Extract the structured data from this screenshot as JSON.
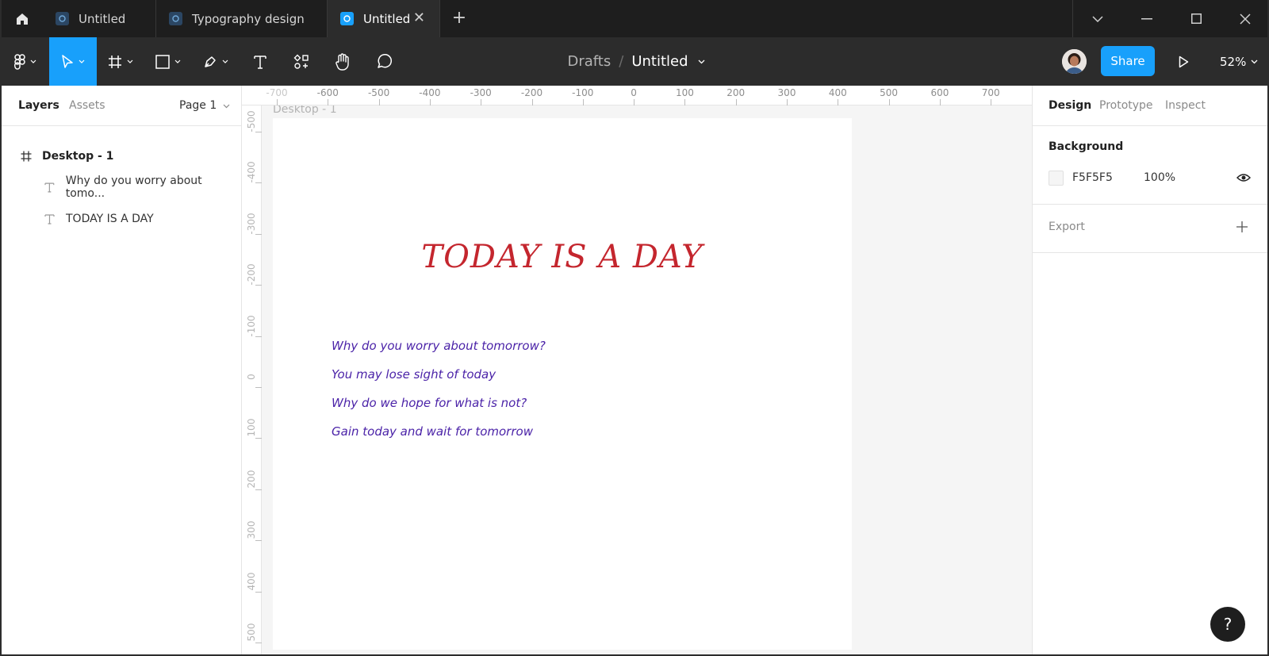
{
  "tabs": [
    {
      "label": "Untitled",
      "active": false
    },
    {
      "label": "Typography design",
      "active": false
    },
    {
      "label": "Untitled",
      "active": true
    }
  ],
  "toolbar": {
    "breadcrumb_root": "Drafts",
    "breadcrumb_sep": "/",
    "file_name": "Untitled",
    "share_label": "Share",
    "zoom": "52%"
  },
  "layers_panel": {
    "tab_layers": "Layers",
    "tab_assets": "Assets",
    "page": "Page 1",
    "items": [
      {
        "label": "Desktop - 1",
        "type": "frame"
      },
      {
        "label": "Why do you worry about tomo...",
        "type": "text"
      },
      {
        "label": "TODAY IS A DAY",
        "type": "text"
      }
    ]
  },
  "rulers": {
    "horizontal": [
      "-700",
      "-600",
      "-500",
      "-400",
      "-300",
      "-200",
      "-100",
      "0",
      "100",
      "200",
      "300",
      "400",
      "500",
      "600",
      "700"
    ],
    "vertical": [
      "-500",
      "-400",
      "-300",
      "-200",
      "-100",
      "0",
      "100",
      "200",
      "300",
      "400",
      "500"
    ]
  },
  "canvas": {
    "frame_label": "Desktop - 1",
    "heading": "TODAY IS A DAY",
    "heading_color": "#c4262e",
    "lines": [
      "Why do you worry about tomorrow?",
      "You may lose sight of today",
      "Why do we hope for what is not?",
      "Gain today and wait for tomorrow"
    ],
    "lines_color": "#4b23a8"
  },
  "design_panel": {
    "tab_design": "Design",
    "tab_prototype": "Prototype",
    "tab_inspect": "Inspect",
    "background_title": "Background",
    "background_hex": "F5F5F5",
    "background_opacity": "100%",
    "export_title": "Export"
  },
  "help_label": "?"
}
